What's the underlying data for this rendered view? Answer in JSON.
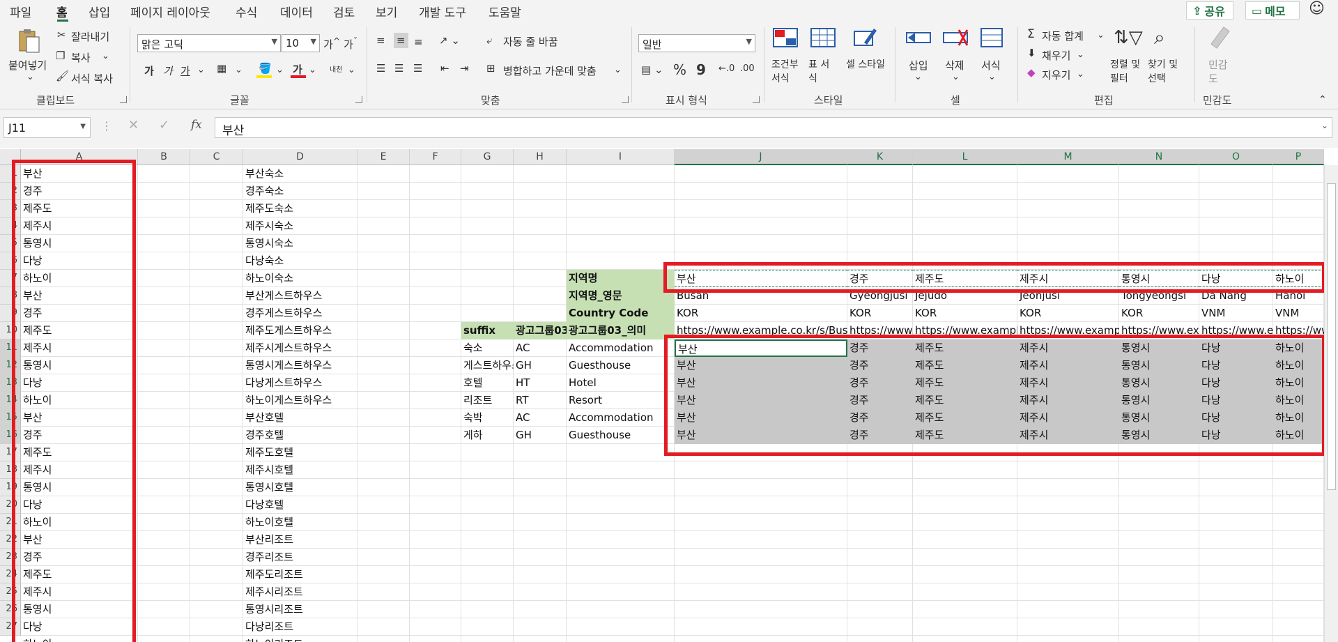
{
  "menu": {
    "items": [
      "파일",
      "홈",
      "삽입",
      "페이지 레이아웃",
      "수식",
      "데이터",
      "검토",
      "보기",
      "개발 도구",
      "도움말"
    ],
    "share": "공유",
    "memo": "메모"
  },
  "ribbon": {
    "clipboard": {
      "paste": "붙여넣기",
      "cut": "잘라내기",
      "copy": "복사",
      "format_painter": "서식 복사",
      "label": "클립보드"
    },
    "font": {
      "name": "맑은 고딕",
      "size": "10",
      "label": "글꼴",
      "bold": "가",
      "italic": "가",
      "underline": "가",
      "grow": "가",
      "shrink": "가",
      "phonetic": "내천"
    },
    "align": {
      "wrap": "자동 줄 바꿈",
      "merge": "병합하고 가운데 맞춤",
      "label": "맞춤"
    },
    "number": {
      "format": "일반",
      "percent": "%",
      "comma": "9",
      "label": "표시 형식"
    },
    "styles": {
      "conditional": "조건부 서식",
      "table": "표 서식",
      "cell_style": "셀 스타일",
      "label": "스타일"
    },
    "cells": {
      "insert": "삽입",
      "delete": "삭제",
      "format": "서식",
      "label": "셀"
    },
    "editing": {
      "autosum": "자동 합계",
      "fill": "채우기",
      "clear": "지우기",
      "sort": "정렬 및 필터",
      "find": "찾기 및 선택",
      "label": "편집"
    },
    "sensitivity": {
      "button": "민감도",
      "label": "민감도"
    }
  },
  "formula_bar": {
    "name_box": "J11",
    "fx": "fx",
    "value": "부산"
  },
  "columns": [
    "A",
    "B",
    "C",
    "D",
    "E",
    "F",
    "G",
    "H",
    "I",
    "J",
    "K",
    "L",
    "M",
    "N",
    "O",
    "P"
  ],
  "rows": [
    "1",
    "2",
    "3",
    "4",
    "5",
    "6",
    "7",
    "8",
    "9",
    "10",
    "11",
    "12",
    "13",
    "14",
    "15",
    "16",
    "17",
    "18",
    "19",
    "20",
    "21",
    "22",
    "23",
    "24",
    "25",
    "26",
    "27"
  ],
  "colA": [
    "부산",
    "경주",
    "제주도",
    "제주시",
    "통영시",
    "다낭",
    "하노이",
    "부산",
    "경주",
    "제주도",
    "제주시",
    "통영시",
    "다낭",
    "하노이",
    "부산",
    "경주",
    "제주도",
    "제주시",
    "통영시",
    "다낭",
    "하노이",
    "부산",
    "경주",
    "제주도",
    "제주시",
    "통영시",
    "다낭"
  ],
  "colD": [
    "부산숙소",
    "경주숙소",
    "제주도숙소",
    "제주시숙소",
    "통영시숙소",
    "다낭숙소",
    "하노이숙소",
    "부산게스트하우스",
    "경주게스트하우스",
    "제주도게스트하우스",
    "제주시게스트하우스",
    "통영시게스트하우스",
    "다낭게스트하우스",
    "하노이게스트하우스",
    "부산호텔",
    "경주호텔",
    "제주도호텔",
    "제주시호텔",
    "통영시호텔",
    "다낭호텔",
    "하노이호텔",
    "부산리조트",
    "경주리조트",
    "제주도리조트",
    "제주시리조트",
    "통영시리조트",
    "다낭리조트"
  ],
  "colI_labels": {
    "r7": "지역명",
    "r8": "지역명_영문",
    "r9": "Country Code",
    "r10": "광고그룹03_의미"
  },
  "suffix_header": {
    "g": "suffix",
    "h": "광고그룹03"
  },
  "suffix_rows": [
    {
      "g": "숙소",
      "h": "AC",
      "i": "Accommodation"
    },
    {
      "g": "게스트하우스",
      "h": "GH",
      "i": "Guesthouse"
    },
    {
      "g": "호텔",
      "h": "HT",
      "i": "Hotel"
    },
    {
      "g": "리조트",
      "h": "RT",
      "i": "Resort"
    },
    {
      "g": "숙박",
      "h": "AC",
      "i": "Accommodation"
    },
    {
      "g": "게하",
      "h": "GH",
      "i": "Guesthouse"
    }
  ],
  "regions_kr": [
    "부산",
    "경주",
    "제주도",
    "제주시",
    "통영시",
    "다낭",
    "하노이"
  ],
  "regions_en": [
    "Busan",
    "Gyeongjusi",
    "Jejudo",
    "Jeonjusi",
    "Tongyeongsi",
    "Da Nang",
    "Hanoi"
  ],
  "country_codes": [
    "KOR",
    "KOR",
    "KOR",
    "KOR",
    "KOR",
    "VNM",
    "VNM"
  ],
  "urls": [
    "https://www.example.co.kr/s/Busan",
    "https://www.example.c",
    "https://www.example.co",
    "https://www.example.c",
    "https://www.exam",
    "https://www.exa",
    "https://www.exa"
  ],
  "fill_block": [
    [
      "부산",
      "경주",
      "제주도",
      "제주시",
      "통영시",
      "다낭",
      "하노이"
    ],
    [
      "부산",
      "경주",
      "제주도",
      "제주시",
      "통영시",
      "다낭",
      "하노이"
    ],
    [
      "부산",
      "경주",
      "제주도",
      "제주시",
      "통영시",
      "다낭",
      "하노이"
    ],
    [
      "부산",
      "경주",
      "제주도",
      "제주시",
      "통영시",
      "다낭",
      "하노이"
    ],
    [
      "부산",
      "경주",
      "제주도",
      "제주시",
      "통영시",
      "다낭",
      "하노이"
    ],
    [
      "부산",
      "경주",
      "제주도",
      "제주시",
      "통영시",
      "다낭",
      "하노이"
    ]
  ],
  "row28_partial": {
    "a": "하노이",
    "d": "하노이리조트"
  },
  "colors": {
    "accent": "#217346",
    "green_fill": "#c6e0b4",
    "highlight_red": "#e31b23",
    "selection_gray": "#c8c8c8"
  }
}
